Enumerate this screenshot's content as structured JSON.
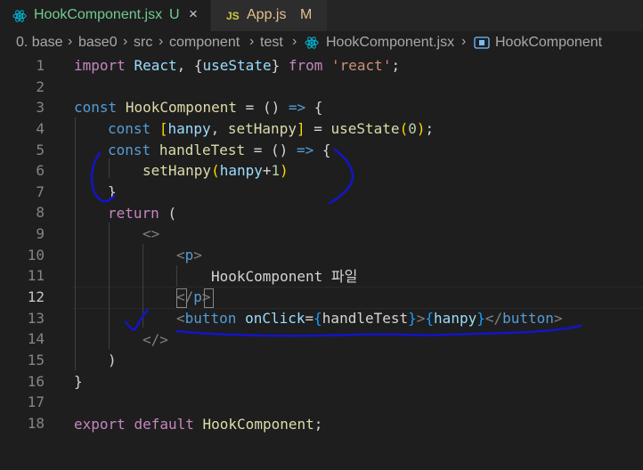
{
  "tabs": [
    {
      "name": "HookComponent.jsx",
      "status": "U",
      "close": "×",
      "active": true,
      "icon": "react-icon"
    },
    {
      "name": "App.js",
      "status": "M",
      "badge": "JS",
      "active": false,
      "icon": "js-icon"
    }
  ],
  "breadcrumb": [
    "0. base",
    "base0",
    "src",
    "component",
    "test",
    "HookComponent.jsx",
    "HookComponent"
  ],
  "line_numbers": [
    "1",
    "2",
    "3",
    "4",
    "5",
    "6",
    "7",
    "8",
    "9",
    "10",
    "11",
    "12",
    "13",
    "14",
    "15",
    "16",
    "17",
    "18"
  ],
  "current_line": "12",
  "code": {
    "l1": {
      "import": "import",
      "react": "React",
      "brace_open": ", {",
      "useState": "useState",
      "brace_close": "} ",
      "from": "from",
      "module": "'react'",
      "semi": ";"
    },
    "l3": {
      "const": "const",
      "name": "HookComponent",
      "rest": " = () ",
      "arrow": "=>",
      "brace": "{"
    },
    "l4": {
      "const": "const",
      "bracket_open": "[",
      "hanpy": "hanpy",
      "comma": ", ",
      "setHanpy": "setHanpy",
      "bracket_close": "]",
      "eq": " = ",
      "useState": "useState",
      "paren_open": "(",
      "zero": "0",
      "paren_close": ")",
      "semi": ";"
    },
    "l5": {
      "const": "const",
      "name": "handleTest",
      "rest": " = () ",
      "arrow": "=>",
      "brace": "{"
    },
    "l6": {
      "fn": "setHanpy",
      "paren_open": "(",
      "var": "hanpy",
      "plus": "+",
      "one": "1",
      "paren_close": ")"
    },
    "l7": {
      "brace": "}"
    },
    "l8": {
      "return": "return",
      "paren": "("
    },
    "l9": {
      "frag": "<>"
    },
    "l10": {
      "lt": "<",
      "tag": "p",
      "gt": ">"
    },
    "l11": {
      "text": "HookComponent 파일"
    },
    "l12": {
      "lt": "</",
      "tag": "p",
      "gt": ">"
    },
    "l13": {
      "lt": "<",
      "tag": "button",
      "attr": "onClick",
      "eq": "=",
      "ob": "{",
      "handler": "handleTest",
      "cb": "}",
      "gt": ">",
      "ob2": "{",
      "val": "hanpy",
      "cb2": "}",
      "close_lt": "</",
      "close_tag": "button",
      "close_gt": ">"
    },
    "l14": {
      "frag": "</>"
    },
    "l15": {
      "paren": ")"
    },
    "l16": {
      "brace": "}"
    },
    "l18": {
      "export": "export",
      "default": "default",
      "name": "HookComponent",
      "semi": ";"
    }
  }
}
